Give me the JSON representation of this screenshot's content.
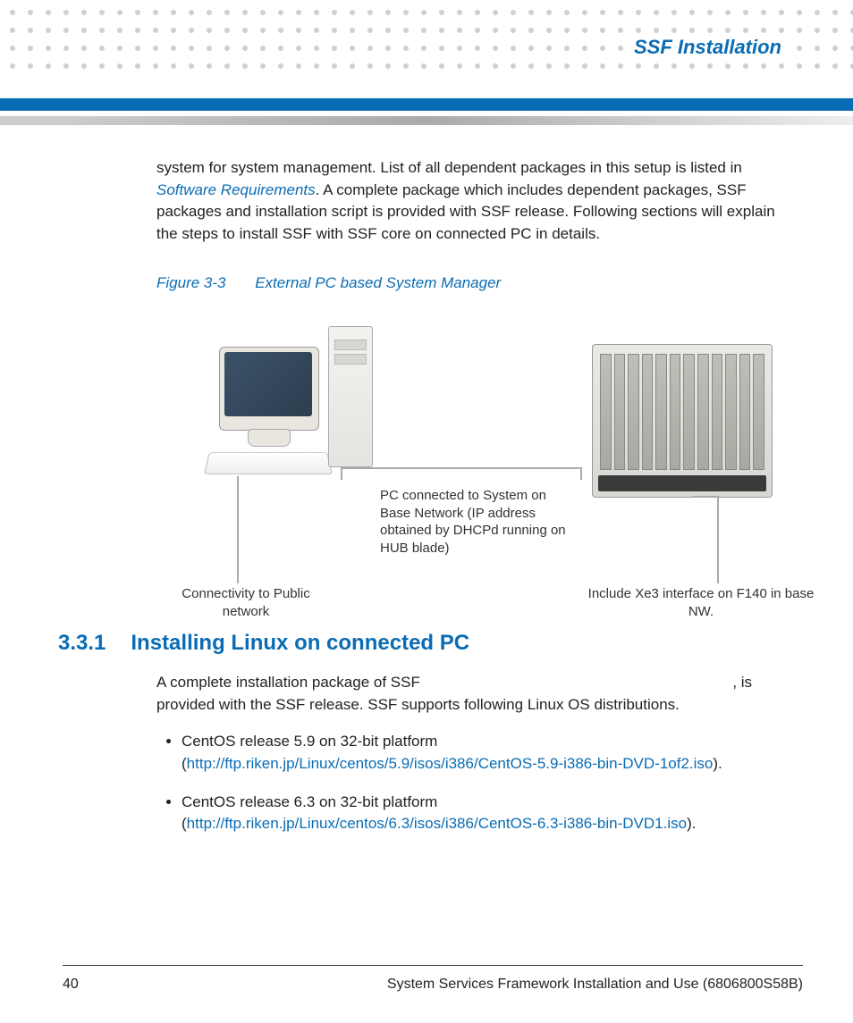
{
  "header": {
    "title": "SSF Installation"
  },
  "intro": {
    "before_link": "system for system management. List of all dependent packages in this setup is listed in ",
    "link_text": "Software Requirements",
    "after_link": ". A complete package which includes dependent packages, SSF packages and installation script is provided with SSF release. Following sections will explain the steps to install SSF with SSF core on connected PC in details."
  },
  "figure": {
    "number": "Figure 3-3",
    "title": "External PC based System Manager",
    "label_pc": "PC connected to System on Base Network (IP address obtained by DHCPd running on HUB blade)",
    "label_connectivity": "Connectivity to Public network",
    "label_xe3": "Include Xe3 interface on F140 in base NW."
  },
  "section": {
    "number": "3.3.1",
    "title": "Installing Linux on connected PC",
    "para_before": "A complete installation package of SSF",
    "para_after": ", is provided with the SSF release. SSF supports following Linux OS distributions.",
    "items": [
      {
        "text": "CentOS release 5.9 on 32-bit platform (",
        "url": "http://ftp.riken.jp/Linux/centos/5.9/isos/i386/CentOS-5.9-i386-bin-DVD-1of2.iso",
        "after": ")."
      },
      {
        "text": "CentOS release 6.3 on 32-bit platform (",
        "url": "http://ftp.riken.jp/Linux/centos/6.3/isos/i386/CentOS-6.3-i386-bin-DVD1.iso",
        "after": ")."
      }
    ]
  },
  "footer": {
    "page": "40",
    "doc": "System Services Framework Installation and Use (6806800S58B)"
  }
}
